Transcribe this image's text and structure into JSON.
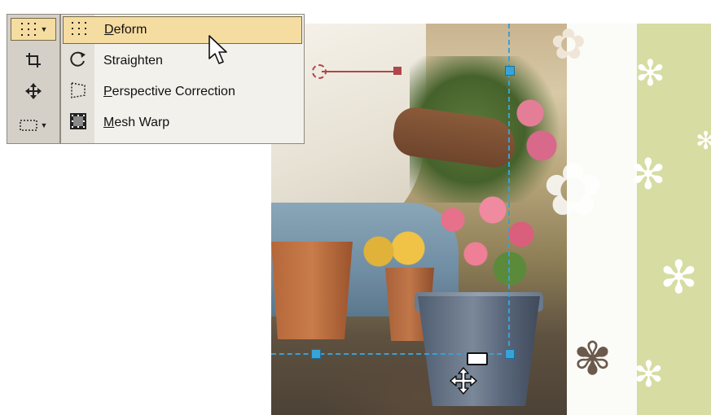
{
  "toolbar": {
    "tools": [
      {
        "icon": "⁝⁝⁝",
        "has_dropdown": true,
        "active": true
      },
      {
        "icon": "⌗"
      },
      {
        "icon": "✥"
      },
      {
        "icon": "⬚",
        "has_dropdown": true
      }
    ],
    "dropdown_glyph": "▼"
  },
  "menu": {
    "items": [
      {
        "label_first": "D",
        "label_rest": "eform",
        "icon": "deform-icon",
        "highlighted": true
      },
      {
        "label_first": "",
        "label_rest": "Straighten",
        "icon": "straighten-icon"
      },
      {
        "label_first": "P",
        "label_rest": "erspective Correction",
        "icon": "perspective-correction-icon"
      },
      {
        "label_first": "M",
        "label_rest": "esh Warp",
        "icon": "mesh-warp-icon"
      }
    ]
  },
  "colors": {
    "highlight": "#f5dca0",
    "toolbar_bg": "#d4d0c8",
    "guide": "#3aa0d4",
    "rotation": "#b0454a"
  }
}
